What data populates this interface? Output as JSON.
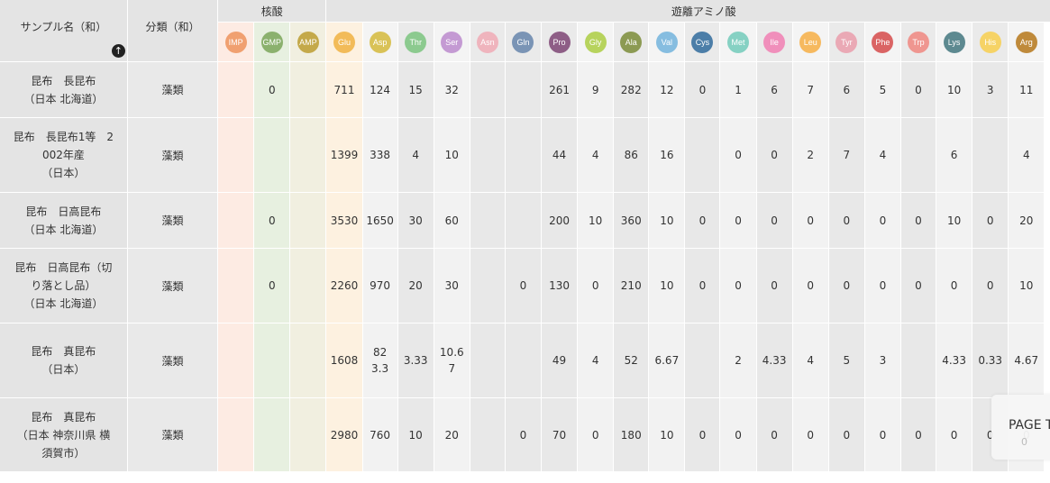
{
  "header": {
    "sample_label": "サンプル名（和）",
    "category_label": "分類（和）",
    "group_nucleic": "核酸",
    "group_amino": "遊離アミノ酸",
    "sort_icon": "arrow-up-icon"
  },
  "columns": [
    {
      "key": "IMP",
      "label": "IMP",
      "color": "#f0a070"
    },
    {
      "key": "GMP",
      "label": "GMP",
      "color": "#8bb16e"
    },
    {
      "key": "AMP",
      "label": "AMP",
      "color": "#c4a94a"
    },
    {
      "key": "Glu",
      "label": "Glu",
      "color": "#f2bb59"
    },
    {
      "key": "Asp",
      "label": "Asp",
      "color": "#d9c257"
    },
    {
      "key": "Thr",
      "label": "Thr",
      "color": "#8cca8f"
    },
    {
      "key": "Ser",
      "label": "Ser",
      "color": "#c49ad3"
    },
    {
      "key": "Asn",
      "label": "Asn",
      "color": "#efb4bd"
    },
    {
      "key": "Gln",
      "label": "Gln",
      "color": "#7a94b5"
    },
    {
      "key": "Pro",
      "label": "Pro",
      "color": "#8e5e86"
    },
    {
      "key": "Gly",
      "label": "Gly",
      "color": "#b7d35d"
    },
    {
      "key": "Ala",
      "label": "Ala",
      "color": "#8c9a53"
    },
    {
      "key": "Val",
      "label": "Val",
      "color": "#86bde0"
    },
    {
      "key": "Cys",
      "label": "Cys",
      "color": "#4c7ea8"
    },
    {
      "key": "Met",
      "label": "Met",
      "color": "#86d1c3"
    },
    {
      "key": "Ile",
      "label": "Ile",
      "color": "#f08fbb"
    },
    {
      "key": "Leu",
      "label": "Leu",
      "color": "#f6b95f"
    },
    {
      "key": "Tyr",
      "label": "Tyr",
      "color": "#eaa9b5"
    },
    {
      "key": "Phe",
      "label": "Phe",
      "color": "#da6464"
    },
    {
      "key": "Trp",
      "label": "Trp",
      "color": "#ef9690"
    },
    {
      "key": "Lys",
      "label": "Lys",
      "color": "#5d8990"
    },
    {
      "key": "His",
      "label": "His",
      "color": "#f6d366"
    },
    {
      "key": "Arg",
      "label": "Arg",
      "color": "#bf8a3b"
    }
  ],
  "rows": [
    {
      "name": [
        "昆布　長昆布",
        "（日本 北海道）"
      ],
      "category": "藻類",
      "values": {
        "IMP": "",
        "GMP": "0",
        "AMP": "",
        "Glu": "711",
        "Asp": "124",
        "Thr": "15",
        "Ser": "32",
        "Asn": "",
        "Gln": "",
        "Pro": "261",
        "Gly": "9",
        "Ala": "282",
        "Val": "12",
        "Cys": "0",
        "Met": "1",
        "Ile": "6",
        "Leu": "7",
        "Tyr": "6",
        "Phe": "5",
        "Trp": "0",
        "Lys": "10",
        "His": "3",
        "Arg": "11"
      }
    },
    {
      "name": [
        "昆布　長昆布1等　2",
        "002年産",
        "（日本）"
      ],
      "category": "藻類",
      "values": {
        "IMP": "",
        "GMP": "",
        "AMP": "",
        "Glu": "1399",
        "Asp": "338",
        "Thr": "4",
        "Ser": "10",
        "Asn": "",
        "Gln": "",
        "Pro": "44",
        "Gly": "4",
        "Ala": "86",
        "Val": "16",
        "Cys": "",
        "Met": "0",
        "Ile": "0",
        "Leu": "2",
        "Tyr": "7",
        "Phe": "4",
        "Trp": "",
        "Lys": "6",
        "His": "",
        "Arg": "4"
      }
    },
    {
      "name": [
        "昆布　日高昆布",
        "（日本 北海道）"
      ],
      "category": "藻類",
      "values": {
        "IMP": "",
        "GMP": "0",
        "AMP": "",
        "Glu": "3530",
        "Asp": "1650",
        "Thr": "30",
        "Ser": "60",
        "Asn": "",
        "Gln": "",
        "Pro": "200",
        "Gly": "10",
        "Ala": "360",
        "Val": "10",
        "Cys": "0",
        "Met": "0",
        "Ile": "0",
        "Leu": "0",
        "Tyr": "0",
        "Phe": "0",
        "Trp": "0",
        "Lys": "10",
        "His": "0",
        "Arg": "20"
      }
    },
    {
      "name": [
        "昆布　日高昆布（切",
        "り落とし品）",
        "（日本 北海道）"
      ],
      "category": "藻類",
      "values": {
        "IMP": "",
        "GMP": "0",
        "AMP": "",
        "Glu": "2260",
        "Asp": "970",
        "Thr": "20",
        "Ser": "30",
        "Asn": "",
        "Gln": "0",
        "Pro": "130",
        "Gly": "0",
        "Ala": "210",
        "Val": "10",
        "Cys": "0",
        "Met": "0",
        "Ile": "0",
        "Leu": "0",
        "Tyr": "0",
        "Phe": "0",
        "Trp": "0",
        "Lys": "0",
        "His": "0",
        "Arg": "10"
      }
    },
    {
      "name": [
        "昆布　真昆布",
        "（日本）"
      ],
      "category": "藻類",
      "values": {
        "IMP": "",
        "GMP": "",
        "AMP": "",
        "Glu": "1608",
        "Asp": "823.3",
        "Thr": "3.33",
        "Ser": "10.67",
        "Asn": "",
        "Gln": "",
        "Pro": "49",
        "Gly": "4",
        "Ala": "52",
        "Val": "6.67",
        "Cys": "",
        "Met": "2",
        "Ile": "4.33",
        "Leu": "4",
        "Tyr": "5",
        "Phe": "3",
        "Trp": "",
        "Lys": "4.33",
        "His": "0.33",
        "Arg": "4.67"
      }
    },
    {
      "name": [
        "昆布　真昆布",
        "（日本 神奈川県 横",
        "須賀市）"
      ],
      "category": "藻類",
      "values": {
        "IMP": "",
        "GMP": "",
        "AMP": "",
        "Glu": "2980",
        "Asp": "760",
        "Thr": "10",
        "Ser": "20",
        "Asn": "",
        "Gln": "0",
        "Pro": "70",
        "Gly": "0",
        "Ala": "180",
        "Val": "10",
        "Cys": "0",
        "Met": "0",
        "Ile": "0",
        "Leu": "0",
        "Tyr": "0",
        "Phe": "0",
        "Trp": "0",
        "Lys": "0",
        "His": "0",
        "Arg": "0"
      }
    }
  ],
  "page_widget": {
    "label": "PAGE T",
    "number": "0"
  }
}
